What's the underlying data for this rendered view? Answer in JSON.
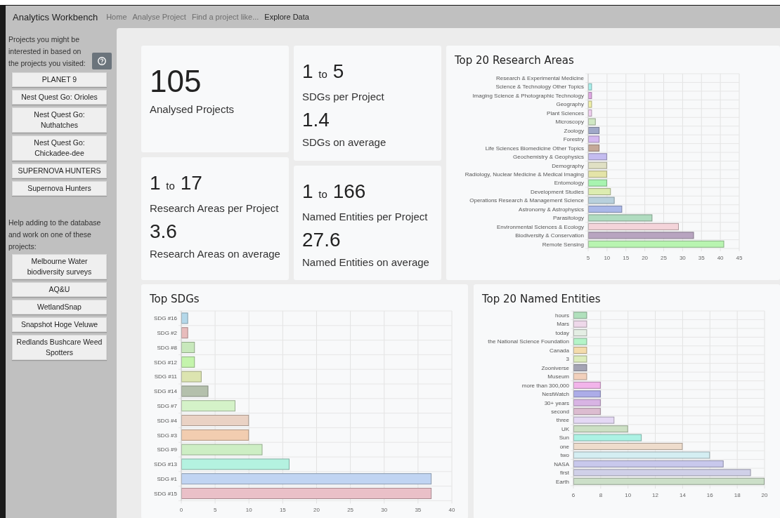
{
  "nav": {
    "title": "Analytics Workbench",
    "links": [
      {
        "label": "Home",
        "selected": false
      },
      {
        "label": "Analyse Project",
        "selected": false
      },
      {
        "label": "Find a project like...",
        "selected": false
      },
      {
        "label": "Explore Data",
        "selected": true
      }
    ]
  },
  "sidebar": {
    "recommend_text": "Projects you might be interested in based on the projects you visited:",
    "recommended": [
      "PLANET 9",
      "Nest Quest Go: Orioles",
      "Nest Quest Go: Nuthatches",
      "Nest Quest Go: Chickadee-dee",
      "SUPERNOVA HUNTERS",
      "Supernova Hunters"
    ],
    "help_text": "Help adding to the database and work on one of these projects:",
    "help_projects": [
      "Melbourne Water biodiversity surveys",
      "AQ&U",
      "WetlandSnap",
      "Snapshot Hoge Veluwe",
      "Redlands Bushcare Weed Spotters"
    ]
  },
  "stats": [
    {
      "kind": "single",
      "value": "105",
      "label": "Analysed Projects"
    },
    {
      "kind": "range",
      "from": "1",
      "connector": "to",
      "to": "17",
      "label": "Research Areas per Project",
      "average": "3.6",
      "average_label": "Research Areas on average"
    },
    {
      "kind": "range",
      "from": "1",
      "connector": "to",
      "to": "5",
      "label": "SDGs per Project",
      "average": "1.4",
      "average_label": "SDGs on average"
    },
    {
      "kind": "range",
      "from": "1",
      "connector": "to",
      "to": "166",
      "label": "Named Entities per Project",
      "average": "27.6",
      "average_label": "Named Entities on average"
    }
  ],
  "research_areas": {
    "title": "Top 20 Research Areas",
    "chart_data": {
      "type": "bar",
      "orientation": "horizontal",
      "categories": [
        "Research & Experimental Medicine",
        "Science & Technology Other Topics",
        "Imaging Science & Photographic Technology",
        "Geography",
        "Plant Sciences",
        "Microscopy",
        "Zoology",
        "Forestry",
        "Life Sciences Biomedicine Other Topics",
        "Geochemistry & Geophysics",
        "Demography",
        "Radiology, Nuclear Medicine & Medical Imaging",
        "Entomology",
        "Development Studies",
        "Operations Research & Management Science",
        "Astronomy & Astrophysics",
        "Parasitology",
        "Environmental Sciences & Ecology",
        "Biodiversity & Conservation",
        "Remote Sensing"
      ],
      "values": [
        5,
        6,
        6,
        6,
        6,
        7,
        8,
        8,
        8,
        10,
        10,
        10,
        10,
        11,
        12,
        14,
        22,
        29,
        33,
        41
      ],
      "colors": [
        "#e0e0e0",
        "#a8f0ec",
        "#e0a8e4",
        "#f0f0a8",
        "#f0d0f0",
        "#d0e8c4",
        "#a0a8c8",
        "#d4b8f0",
        "#c4a898",
        "#c4bcf0",
        "#e0e0c4",
        "#e4e4a8",
        "#a8f4b0",
        "#dcecb0",
        "#b8d0dc",
        "#aab8e8",
        "#b0dcc0",
        "#f4d4da",
        "#b8a4c0",
        "#b8f4b0"
      ],
      "grid": true,
      "xlim": [
        5,
        45
      ],
      "xticks": [
        5,
        10,
        15,
        20,
        25,
        30,
        35,
        40,
        45
      ]
    }
  },
  "sdgs": {
    "title": "Top SDGs",
    "chart_data": {
      "type": "bar",
      "orientation": "horizontal",
      "categories": [
        "SDG #16",
        "SDG #2",
        "SDG #8",
        "SDG #12",
        "SDG #11",
        "SDG #14",
        "SDG #7",
        "SDG #4",
        "SDG #3",
        "SDG #9",
        "SDG #13",
        "SDG #1",
        "SDG #15"
      ],
      "values": [
        1,
        1,
        2,
        2,
        3,
        4,
        8,
        10,
        10,
        12,
        16,
        37,
        37
      ],
      "colors": [
        "#b4d8ea",
        "#e8bcbc",
        "#c8e8bc",
        "#c4f4ac",
        "#dce4b0",
        "#b4c0ac",
        "#d4f2c8",
        "#ead2c4",
        "#f2cdb0",
        "#cdeec4",
        "#b4f2e0",
        "#c0d4f2",
        "#eac0c8"
      ],
      "grid": true,
      "xlim": [
        0,
        40
      ],
      "xticks": [
        0,
        5,
        10,
        15,
        20,
        25,
        30,
        35,
        40
      ]
    }
  },
  "named_entities": {
    "title": "Top 20 Named Entities",
    "chart_data": {
      "type": "bar",
      "orientation": "horizontal",
      "categories": [
        "hours",
        "Mars",
        "today",
        "the National Science Foundation",
        "Canada",
        "3",
        "Zooniverse",
        "Museum",
        "more than 300,000",
        "NestWatch",
        "30+ years",
        "second",
        "three",
        "UK",
        "Sun",
        "one",
        "two",
        "NASA",
        "first",
        "Earth"
      ],
      "values": [
        7,
        7,
        7,
        7,
        7,
        7,
        7,
        7,
        8,
        8,
        8,
        8,
        9,
        10,
        11,
        14,
        16,
        17,
        19,
        20
      ],
      "colors": [
        "#b0e0bc",
        "#eed8ea",
        "#e4eee4",
        "#b4f4c8",
        "#f4dcac",
        "#dcecbc",
        "#a4a4b4",
        "#f2d0bc",
        "#f2b4ea",
        "#acace8",
        "#d8b4e4",
        "#dcbcd0",
        "#e4d8f4",
        "#cce0c4",
        "#acf2e4",
        "#eedccc",
        "#d4eef2",
        "#c8c8ec",
        "#d0d0e8",
        "#ccdfc8"
      ],
      "grid": true,
      "xlim": [
        6,
        20
      ],
      "xticks": [
        6,
        8,
        10,
        12,
        14,
        16,
        18,
        20
      ]
    }
  }
}
